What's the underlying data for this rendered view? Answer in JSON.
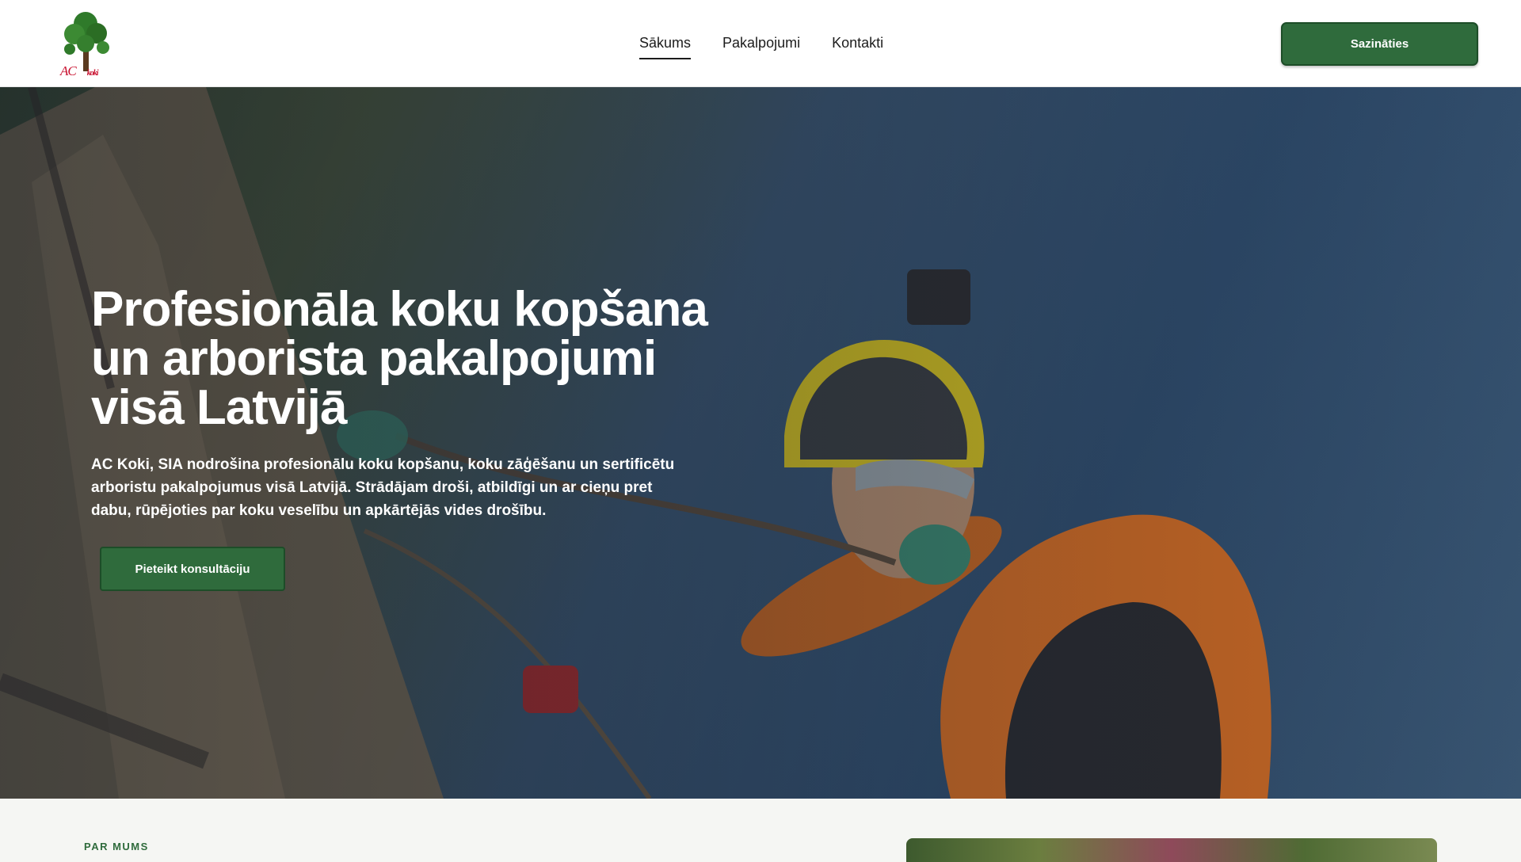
{
  "header": {
    "logo_text": "AC",
    "logo_sub": "koki",
    "nav": [
      "Sākums",
      "Pakalpojumi",
      "Kontakti"
    ],
    "cta_label": "Sazināties"
  },
  "hero": {
    "title": "Profesionāla koku kopšana un arborista pakalpojumi visā Latvijā",
    "description": "AC Koki, SIA nodrošina profesionālu koku kopšanu, koku zāģēšanu un sertificētu arboristu pakalpojumus visā Latvijā. Strādājam droši, atbildīgi un ar cieņu pret dabu, rūpējoties par koku veselību un apkārtējās vides drošību.",
    "button_label": "Pieteikt konsultāciju"
  },
  "about": {
    "label": "PAR MUMS"
  },
  "colors": {
    "accent": "#2f6b3c",
    "accent_border": "#1d4d28"
  }
}
